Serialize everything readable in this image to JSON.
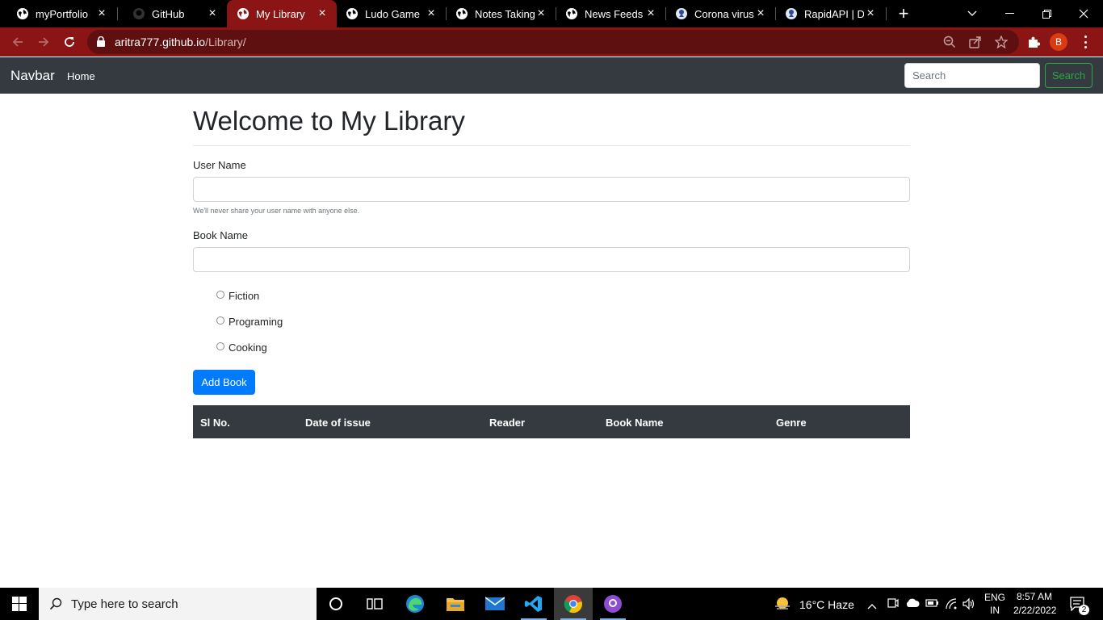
{
  "browser": {
    "tabs": [
      {
        "title": "myPortfolio",
        "icon": "globe-icon"
      },
      {
        "title": "GitHub",
        "icon": "github-icon"
      },
      {
        "title": "My Library",
        "icon": "globe-icon",
        "active": true
      },
      {
        "title": "Ludo Game",
        "icon": "globe-icon"
      },
      {
        "title": "Notes Taking",
        "icon": "globe-icon"
      },
      {
        "title": "News Feeds",
        "icon": "globe-icon"
      },
      {
        "title": "Corona virus",
        "icon": "rapidapi-icon"
      },
      {
        "title": "RapidAPI | De",
        "icon": "rapidapi-icon"
      }
    ],
    "url_host": "aritra777.github.io",
    "url_path": "/Library/",
    "profile_initial": "B",
    "accent_color": "#8b1414"
  },
  "navbar": {
    "brand": "Navbar",
    "home_link": "Home",
    "search_placeholder": "Search",
    "search_button": "Search"
  },
  "page": {
    "heading": "Welcome to My Library",
    "user_name_label": "User Name",
    "user_name_value": "",
    "user_name_help": "We'll never share your user name with anyone else.",
    "book_name_label": "Book Name",
    "book_name_value": "",
    "genres": [
      "Fiction",
      "Programing",
      "Cooking"
    ],
    "add_button": "Add Book",
    "table_headers": [
      "Sl No.",
      "Date of issue",
      "Reader",
      "Book Name",
      "Genre"
    ]
  },
  "taskbar": {
    "search_placeholder": "Type here to search",
    "weather": "16°C  Haze",
    "language_line1": "ENG",
    "language_line2": "IN",
    "time": "8:57 AM",
    "date": "2/22/2022",
    "notification_count": "2"
  }
}
